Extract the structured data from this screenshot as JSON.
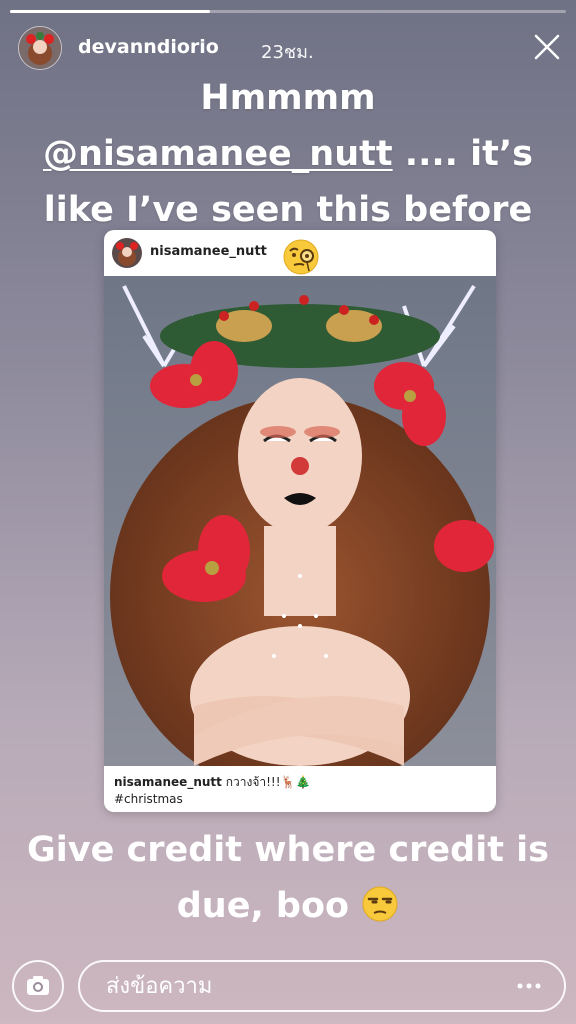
{
  "story": {
    "progress": 0.36,
    "user": {
      "username": "devanndiorio",
      "time_ago": "23ชม."
    },
    "caption_top": {
      "line1": "Hmmmm",
      "mention": "@nisamanee_nutt",
      "line2_rest": " .... it’s",
      "line3": "like I’ve seen this before"
    },
    "embedded_post": {
      "username": "nisamanee_nutt",
      "caption_username": "nisamanee_nutt",
      "caption_text": "กวางจ้า!!!🦌🎄",
      "hashtag": "#christmas",
      "emoji": "monocle-face"
    },
    "caption_bottom": {
      "text": "Give credit where credit is due, boo",
      "emoji": "unamused-face"
    },
    "reply": {
      "placeholder": "ส่งข้อความ"
    }
  },
  "colors": {
    "background_top": "#6f7184",
    "background_bottom": "#cdb7c0",
    "text": "#ffffff"
  }
}
